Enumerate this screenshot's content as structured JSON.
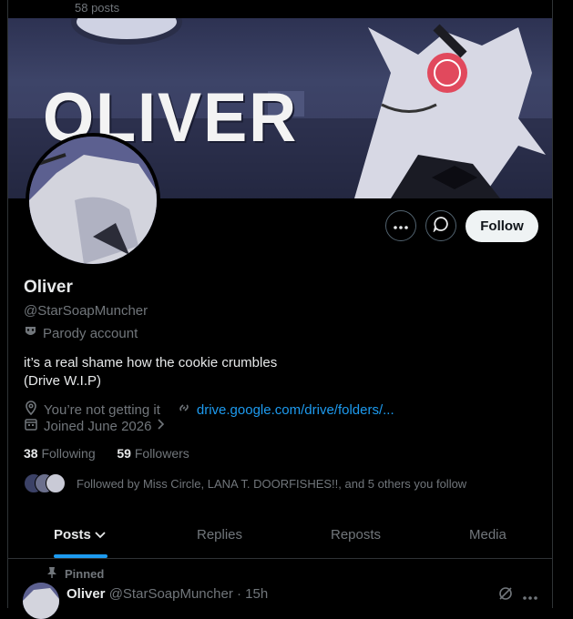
{
  "header": {
    "post_count": "58 posts"
  },
  "banner": {
    "word": "OLIVER"
  },
  "actions": {
    "follow_label": "Follow"
  },
  "profile": {
    "display_name": "Oliver",
    "handle": "@StarSoapMuncher",
    "parody_label": "Parody account",
    "bio_line1": "it’s a real shame how the cookie crumbles",
    "bio_line2": "(Drive W.I.P)",
    "location": "You’re not getting it",
    "link": "drive.google.com/drive/folders/...",
    "joined": "Joined June 2026"
  },
  "stats": {
    "following_count": "38",
    "following_label": "Following",
    "followers_count": "59",
    "followers_label": "Followers"
  },
  "followed_by": "Followed by Miss Circle, LANA T. DOORFISHES!!, and 5 others you follow",
  "tabs": [
    {
      "label": "Posts"
    },
    {
      "label": "Replies"
    },
    {
      "label": "Reposts"
    },
    {
      "label": "Media"
    }
  ],
  "pinned_tweet": {
    "pinned_label": "Pinned",
    "author": "Oliver",
    "handle_time": "@StarSoapMuncher · 15h"
  },
  "colors": {
    "accent": "#1d9bf0",
    "background": "#000000",
    "secondary_text": "#71767b"
  }
}
